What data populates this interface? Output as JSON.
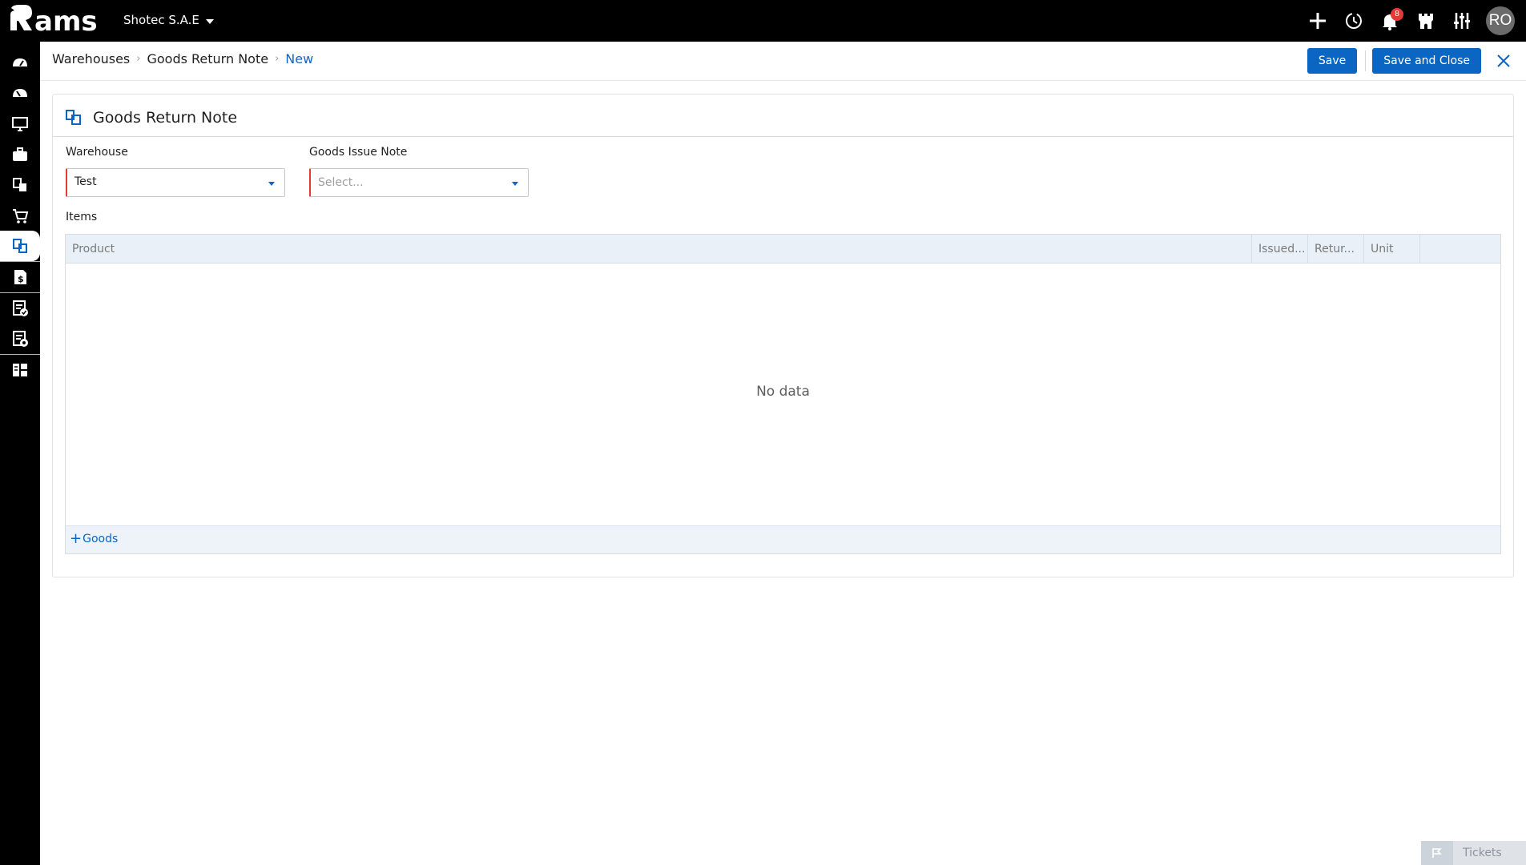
{
  "topbar": {
    "logo": "Rams",
    "company": "Shotec S.A.E",
    "notifications_count": "8",
    "user_initials": "RO",
    "icons": [
      "plus-icon",
      "history-icon",
      "bell-icon",
      "castle-icon",
      "sliders-icon"
    ]
  },
  "sidebar": {
    "items": [
      "dashboard-icon",
      "dashboard-alt-icon",
      "monitor-icon",
      "briefcase-icon",
      "warehouse-doc-icon",
      "cart-icon",
      "goods-return-icon",
      "money-doc-icon",
      "doc-check-icon",
      "doc-settings-icon",
      "layout-icon"
    ],
    "active_index": 6
  },
  "breadcrumb": {
    "items": [
      "Warehouses",
      "Goods Return Note",
      "New"
    ]
  },
  "actions": {
    "save": "Save",
    "save_close": "Save and Close"
  },
  "form": {
    "title": "Goods Return Note",
    "warehouse": {
      "label": "Warehouse",
      "value": "Test"
    },
    "goods_issue_note": {
      "label": "Goods Issue Note",
      "placeholder": "Select..."
    },
    "items_label": "Items"
  },
  "grid": {
    "columns": [
      "Product",
      "Issued...",
      "Retur...",
      "Unit"
    ],
    "empty_text": "No data",
    "add_label": "Goods"
  },
  "tickets": {
    "label": "Tickets"
  },
  "colors": {
    "accent": "#0a66c2",
    "topbar": "#000000",
    "required": "#e53935"
  }
}
